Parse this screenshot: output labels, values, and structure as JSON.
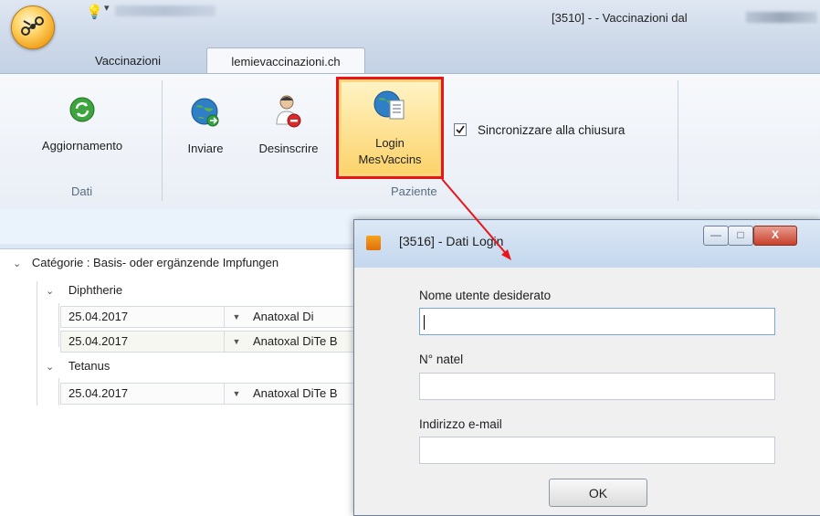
{
  "window": {
    "title": "[3510] - - Vaccinazioni dal",
    "quick_access": [
      "lightbulb-icon",
      "customize-quick-access-icon"
    ]
  },
  "tabs": [
    {
      "label": "Vaccinazioni",
      "active": false
    },
    {
      "label": "lemievaccinazioni.ch",
      "active": true
    }
  ],
  "ribbon": {
    "groups": [
      {
        "label": "Dati",
        "buttons": [
          {
            "label": "Aggiornamento",
            "icon": "refresh-icon"
          }
        ]
      },
      {
        "label": "Paziente",
        "buttons": [
          {
            "label": "Inviare",
            "icon": "globe-send-icon"
          },
          {
            "label": "Desinscrire",
            "icon": "user-remove-icon"
          },
          {
            "label_line1": "Login",
            "label_line2": "MesVaccins",
            "icon": "globe-document-icon",
            "highlighted": true
          }
        ]
      }
    ],
    "sync_checkbox": {
      "label": "Sincronizzare alla chiusura",
      "checked": true
    }
  },
  "tree": {
    "category": "Catégorie : Basis- oder ergänzende Impfungen",
    "groups": [
      {
        "name": "Diphtherie",
        "rows": [
          {
            "date": "25.04.2017",
            "vaccine": "Anatoxal Di"
          },
          {
            "date": "25.04.2017",
            "vaccine": "Anatoxal DiTe B"
          }
        ]
      },
      {
        "name": "Tetanus",
        "rows": [
          {
            "date": "25.04.2017",
            "vaccine": "Anatoxal DiTe B"
          }
        ]
      }
    ]
  },
  "dialog": {
    "title": "[3516] - Dati Login",
    "fields": [
      {
        "label": "Nome utente desiderato",
        "value": "",
        "focused": true
      },
      {
        "label": "N° natel",
        "value": ""
      },
      {
        "label": "Indirizzo e-mail",
        "value": ""
      }
    ],
    "ok_label": "OK",
    "window_buttons": [
      "minimize-icon",
      "maximize-icon",
      "close-icon"
    ]
  },
  "colors": {
    "highlight_border": "#e8151b",
    "arrow": "#e8151b",
    "ribbon_bg": "#eef2f8",
    "title_bar": "#d2ddeb",
    "app_orb": "#f3a51f"
  }
}
